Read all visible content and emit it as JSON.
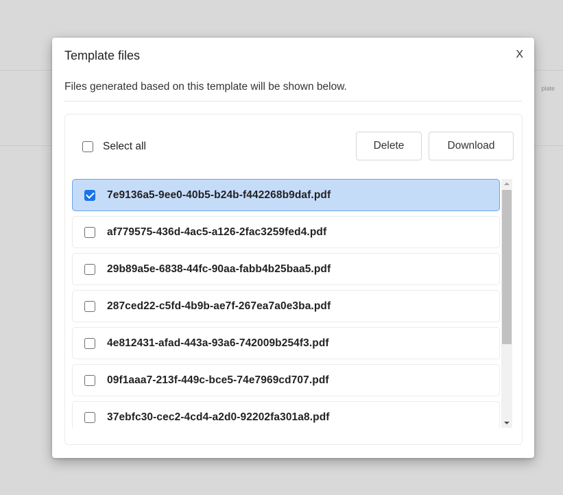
{
  "background": {
    "faint_text": "plate"
  },
  "dialog": {
    "title": "Template files",
    "close_label": "X",
    "subtitle": "Files generated based on this template will be shown below.",
    "select_all_label": "Select all",
    "delete_label": "Delete",
    "download_label": "Download",
    "files": [
      {
        "name": "7e9136a5-9ee0-40b5-b24b-f442268b9daf.pdf",
        "checked": true
      },
      {
        "name": "af779575-436d-4ac5-a126-2fac3259fed4.pdf",
        "checked": false
      },
      {
        "name": "29b89a5e-6838-44fc-90aa-fabb4b25baa5.pdf",
        "checked": false
      },
      {
        "name": "287ced22-c5fd-4b9b-ae7f-267ea7a0e3ba.pdf",
        "checked": false
      },
      {
        "name": "4e812431-afad-443a-93a6-742009b254f3.pdf",
        "checked": false
      },
      {
        "name": "09f1aaa7-213f-449c-bce5-74e7969cd707.pdf",
        "checked": false
      },
      {
        "name": "37ebfc30-cec2-4cd4-a2d0-92202fa301a8.pdf",
        "checked": false
      }
    ]
  },
  "colors": {
    "accent": "#1a73e8",
    "selected_row": "#c5dcf9",
    "overlay": "#d9d9d9"
  }
}
